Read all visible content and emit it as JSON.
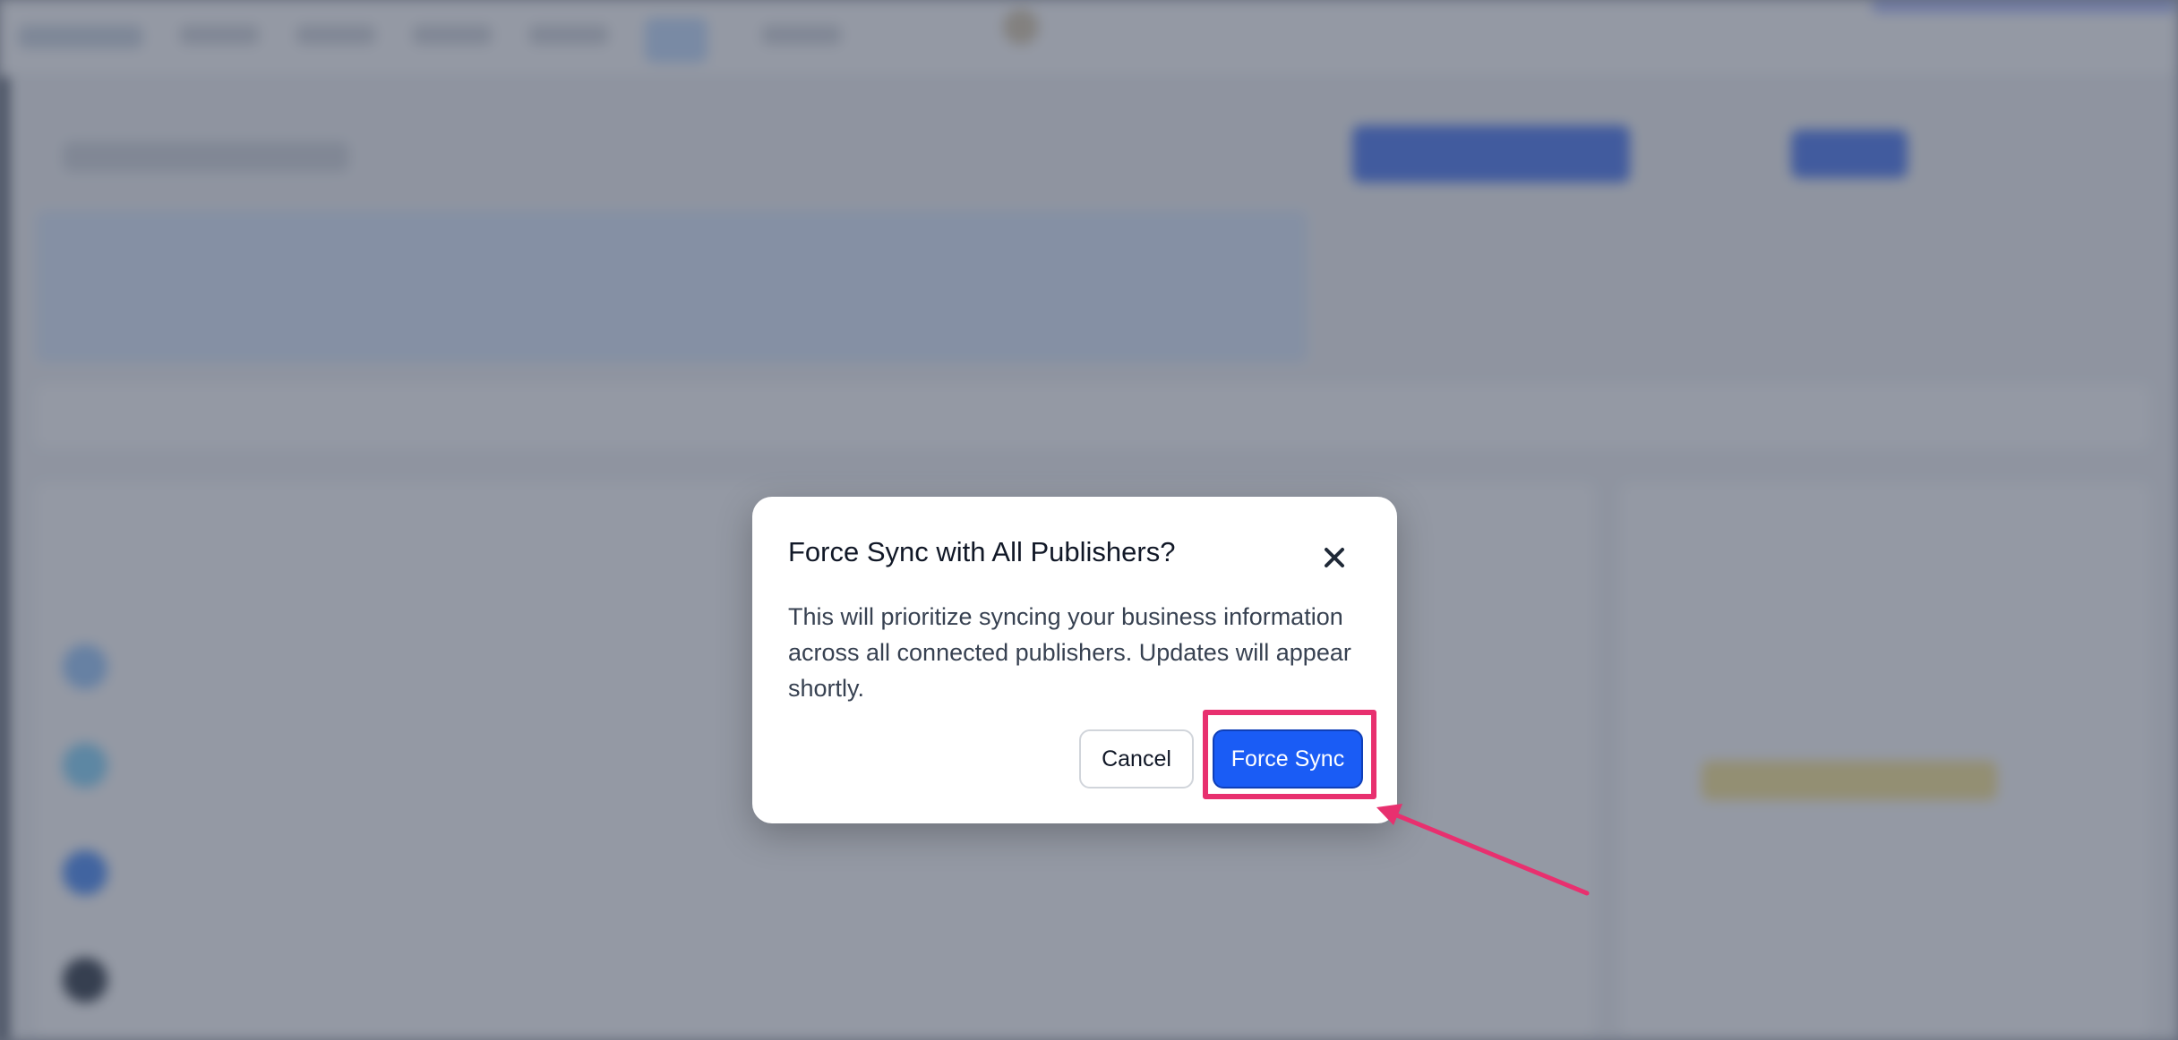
{
  "dialog": {
    "title": "Force Sync with All Publishers?",
    "message": "This will prioritize syncing your business information across all connected publishers. Updates will appear shortly.",
    "cancel_label": "Cancel",
    "confirm_label": "Force Sync"
  },
  "colors": {
    "primary": "#1a5cf5",
    "highlight": "#e8306f",
    "overlay": "#475062"
  },
  "icons": {
    "close": "close-icon"
  }
}
